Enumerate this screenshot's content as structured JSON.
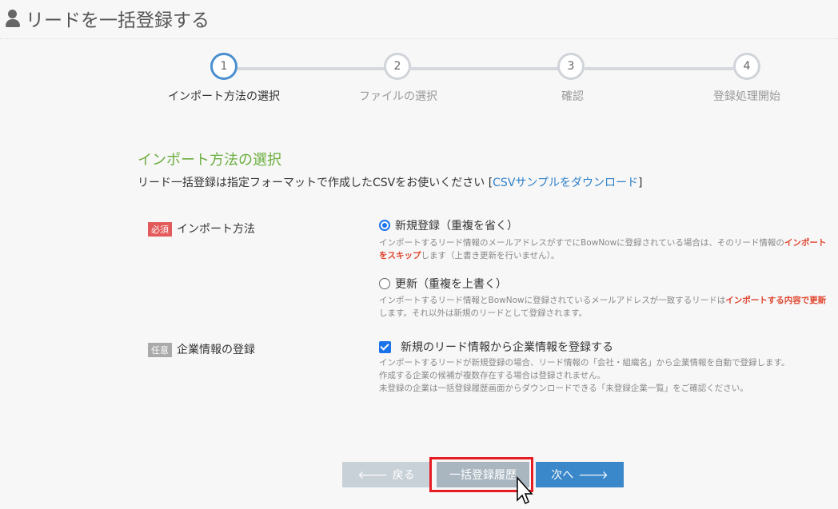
{
  "page": {
    "title": "リードを一括登録する",
    "user_icon": "user-icon"
  },
  "stepper": {
    "steps": [
      {
        "number": "1",
        "label": "インポート方法の選択",
        "active": true
      },
      {
        "number": "2",
        "label": "ファイルの選択",
        "active": false
      },
      {
        "number": "3",
        "label": "確認",
        "active": false
      },
      {
        "number": "4",
        "label": "登録処理開始",
        "active": false
      }
    ]
  },
  "section": {
    "title": "インポート方法の選択",
    "description_prefix": "リード一括登録は指定フォーマットで作成したCSVをお使いください [",
    "description_link": "CSVサンプルをダウンロード",
    "description_suffix": "]"
  },
  "import_method": {
    "badge": "必須",
    "label": "インポート方法",
    "options": [
      {
        "label": "新規登録（重複を省く）",
        "checked": true,
        "note_part1": "インポートするリード情報のメールアドレスがすでにBowNowに登録されている場合は、そのリード情報の",
        "note_emph": "インポートをスキップ",
        "note_part2": "します（上書き更新を行いません）。"
      },
      {
        "label": "更新（重複を上書く）",
        "checked": false,
        "note_part1": "インポートするリード情報とBowNowに登録されているメールアドレスが一致するリードは",
        "note_emph": "インポートする内容で更新",
        "note_part2": "します。それ以外は新規のリードとして登録されます。"
      }
    ]
  },
  "company_info": {
    "badge": "任意",
    "label": "企業情報の登録",
    "checkbox_label": "新規のリード情報から企業情報を登録する",
    "checked": true,
    "note_lines": [
      "インポートするリードが新規登録の場合、リード情報の「会社・組織名」から企業情報を自動で登録します。",
      "作成する企業の候補が複数存在する場合は登録されません。",
      "未登録の企業は一括登録履歴画面からダウンロードできる「未登録企業一覧」をご確認ください。"
    ]
  },
  "buttons": {
    "back": "戻る",
    "history": "一括登録履歴",
    "next": "次へ"
  },
  "colors": {
    "accent": "#3a87c9",
    "section_title": "#6cae3e",
    "emphasis": "#e0442e",
    "highlight": "#e51c23"
  }
}
